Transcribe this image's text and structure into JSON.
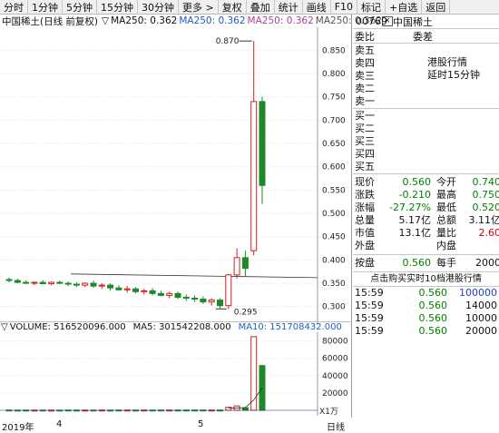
{
  "toolbar": {
    "items": [
      "分时",
      "1分钟",
      "5分钟",
      "15分钟",
      "30分钟",
      "更多 >",
      "复权",
      "叠加",
      "统计",
      "画线",
      "F10",
      "标记",
      "+自选",
      "返回"
    ]
  },
  "legend": {
    "name": "中国稀土(日线 前复权)",
    "indicator": "MA250: 0.362",
    "ma250_1": "MA250: 0.362",
    "ma250_2": "MA250: 0.362",
    "ma250_3": "MA250: 0.362"
  },
  "price_axis": [
    "0.850",
    "0.800",
    "0.750",
    "0.700",
    "0.650",
    "0.600",
    "0.550",
    "0.500",
    "0.450",
    "0.400",
    "0.350",
    "0.300"
  ],
  "annotations": {
    "high": "0.870",
    "low": "0.295"
  },
  "volume": {
    "legend_vol": "VOLUME: 516520096.000",
    "legend_ma5": "MA5: 301542208.000",
    "legend_ma10": "MA10: 151708432.000",
    "axis": [
      "80000",
      "60000",
      "40000",
      "20000"
    ],
    "unit": "X1万"
  },
  "time_axis": {
    "year": "2019年",
    "m4": "4",
    "m5": "5",
    "period": "日线"
  },
  "chart_data": {
    "type": "candlestick",
    "title": "中国稀土(日线 前复权)",
    "ylim": [
      0.28,
      0.88
    ],
    "candles": [
      {
        "o": 0.358,
        "h": 0.362,
        "l": 0.352,
        "c": 0.356
      },
      {
        "o": 0.356,
        "h": 0.36,
        "l": 0.35,
        "c": 0.352
      },
      {
        "o": 0.352,
        "h": 0.356,
        "l": 0.348,
        "c": 0.35
      },
      {
        "o": 0.35,
        "h": 0.354,
        "l": 0.346,
        "c": 0.352
      },
      {
        "o": 0.352,
        "h": 0.357,
        "l": 0.349,
        "c": 0.349
      },
      {
        "o": 0.349,
        "h": 0.354,
        "l": 0.346,
        "c": 0.352
      },
      {
        "o": 0.352,
        "h": 0.356,
        "l": 0.348,
        "c": 0.35
      },
      {
        "o": 0.35,
        "h": 0.354,
        "l": 0.344,
        "c": 0.348
      },
      {
        "o": 0.348,
        "h": 0.352,
        "l": 0.342,
        "c": 0.346
      },
      {
        "o": 0.346,
        "h": 0.352,
        "l": 0.342,
        "c": 0.35
      },
      {
        "o": 0.35,
        "h": 0.356,
        "l": 0.34,
        "c": 0.344
      },
      {
        "o": 0.344,
        "h": 0.35,
        "l": 0.338,
        "c": 0.346
      },
      {
        "o": 0.346,
        "h": 0.35,
        "l": 0.334,
        "c": 0.34
      },
      {
        "o": 0.34,
        "h": 0.346,
        "l": 0.334,
        "c": 0.336
      },
      {
        "o": 0.336,
        "h": 0.344,
        "l": 0.33,
        "c": 0.338
      },
      {
        "o": 0.338,
        "h": 0.342,
        "l": 0.328,
        "c": 0.332
      },
      {
        "o": 0.332,
        "h": 0.338,
        "l": 0.326,
        "c": 0.334
      },
      {
        "o": 0.334,
        "h": 0.34,
        "l": 0.324,
        "c": 0.328
      },
      {
        "o": 0.328,
        "h": 0.334,
        "l": 0.322,
        "c": 0.324
      },
      {
        "o": 0.324,
        "h": 0.332,
        "l": 0.318,
        "c": 0.328
      },
      {
        "o": 0.328,
        "h": 0.332,
        "l": 0.316,
        "c": 0.32
      },
      {
        "o": 0.32,
        "h": 0.326,
        "l": 0.312,
        "c": 0.318
      },
      {
        "o": 0.318,
        "h": 0.324,
        "l": 0.31,
        "c": 0.316
      },
      {
        "o": 0.316,
        "h": 0.322,
        "l": 0.306,
        "c": 0.31
      },
      {
        "o": 0.31,
        "h": 0.318,
        "l": 0.302,
        "c": 0.314
      },
      {
        "o": 0.314,
        "h": 0.318,
        "l": 0.296,
        "c": 0.302
      },
      {
        "o": 0.302,
        "h": 0.37,
        "l": 0.295,
        "c": 0.368
      },
      {
        "o": 0.368,
        "h": 0.425,
        "l": 0.36,
        "c": 0.405
      },
      {
        "o": 0.405,
        "h": 0.42,
        "l": 0.365,
        "c": 0.382
      },
      {
        "o": 0.42,
        "h": 0.87,
        "l": 0.41,
        "c": 0.74
      },
      {
        "o": 0.74,
        "h": 0.75,
        "l": 0.52,
        "c": 0.56
      }
    ],
    "ma250": 0.362,
    "volume_values": [
      300,
      200,
      250,
      200,
      250,
      200,
      200,
      300,
      250,
      250,
      250,
      300,
      250,
      300,
      300,
      250,
      300,
      250,
      300,
      300,
      300,
      300,
      300,
      300,
      300,
      300,
      3500,
      5000,
      3000,
      85000,
      51652
    ]
  },
  "stock": {
    "code": "00769",
    "name": "中国稀土"
  },
  "quote_header": {
    "l": "委比",
    "r": "委差"
  },
  "sells": [
    "卖五",
    "卖四",
    "卖三",
    "卖二",
    "卖一"
  ],
  "buys": [
    "买一",
    "买二",
    "买三",
    "买四",
    "买五"
  ],
  "hk_note": {
    "line1": "港股行情",
    "line2": "延时15分钟"
  },
  "stats": [
    {
      "l1": "现价",
      "v1": "0.560",
      "c1": "green",
      "l2": "今开",
      "v2": "0.740",
      "c2": "green"
    },
    {
      "l1": "涨跌",
      "v1": "-0.210",
      "c1": "green",
      "l2": "最高",
      "v2": "0.750",
      "c2": "green"
    },
    {
      "l1": "涨幅",
      "v1": "-27.27%",
      "c1": "green",
      "l2": "最低",
      "v2": "0.520",
      "c2": "green"
    },
    {
      "l1": "总量",
      "v1": "5.17亿",
      "c1": "black",
      "l2": "总额",
      "v2": "3.11亿",
      "c2": "black"
    },
    {
      "l1": "市值",
      "v1": "13.1亿",
      "c1": "black",
      "l2": "量比",
      "v2": "2.60",
      "c2": "red"
    },
    {
      "l1": "外盘",
      "v1": "",
      "c1": "black",
      "l2": "内盘",
      "v2": "",
      "c2": "black"
    }
  ],
  "lot": {
    "l1": "按盘",
    "v1": "0.560",
    "l2": "每手",
    "v2": "2000"
  },
  "trades_title": "点击购买实时10档港股行情",
  "trades": [
    {
      "t": "15:59",
      "p": "0.560",
      "v": "100000"
    },
    {
      "t": "15:59",
      "p": "0.560",
      "v": "14000"
    },
    {
      "t": "15:59",
      "p": "0.560",
      "v": "10000"
    },
    {
      "t": "15:59",
      "p": "0.560",
      "v": "20000"
    }
  ]
}
